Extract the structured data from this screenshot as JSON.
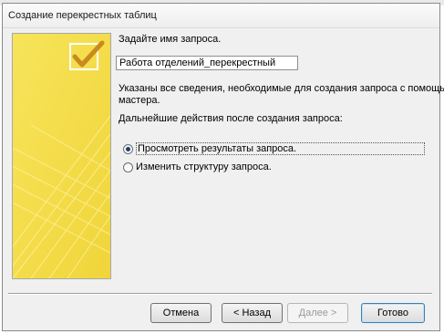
{
  "window": {
    "title": "Создание перекрестных таблиц"
  },
  "form": {
    "name_prompt": "Задайте имя запроса.",
    "query_name_value": "Работа отделений_перекрестный",
    "info_line1": "Указаны все сведения, необходимые для создания запроса с помощью",
    "info_line2": "мастера.",
    "next_actions_label": "Дальнейшие действия после создания запроса:",
    "options": [
      {
        "label": "Просмотреть результаты запроса.",
        "selected": true
      },
      {
        "label": "Изменить структуру запроса.",
        "selected": false
      }
    ]
  },
  "buttons": {
    "cancel": "Отмена",
    "back": "< Назад",
    "next": "Далее >",
    "finish": "Готово"
  },
  "colors": {
    "panel": "#f4e04d",
    "accent": "#3c7fb1"
  }
}
